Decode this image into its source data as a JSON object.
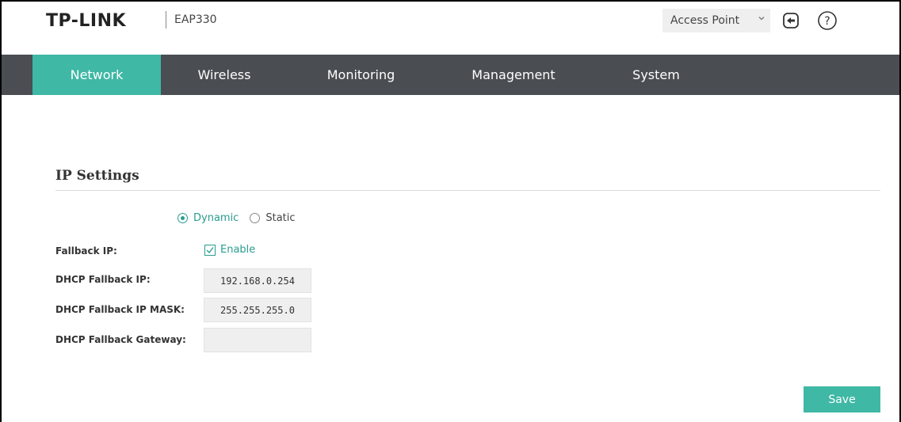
{
  "header": {
    "logo": "TP-LINK",
    "model": "EAP330",
    "mode_select": {
      "value": "Access Point",
      "icon": "chevron-down-icon"
    },
    "logout_icon": "logout-icon",
    "help_icon": "help-icon"
  },
  "nav": {
    "tabs": [
      {
        "label": "Network",
        "active": true
      },
      {
        "label": "Wireless",
        "active": false
      },
      {
        "label": "Monitoring",
        "active": false
      },
      {
        "label": "Management",
        "active": false
      },
      {
        "label": "System",
        "active": false
      }
    ]
  },
  "ip_settings": {
    "title": "IP Settings",
    "mode_options": [
      {
        "label": "Dynamic",
        "selected": true
      },
      {
        "label": "Static",
        "selected": false
      }
    ],
    "fallback_ip": {
      "label": "Fallback IP:",
      "checkbox_label": "Enable",
      "checked": true
    },
    "dhcp_fallback_ip": {
      "label": "DHCP Fallback IP:",
      "value": "192.168.0.254"
    },
    "dhcp_fallback_mask": {
      "label": "DHCP Fallback IP MASK:",
      "value": "255.255.255.0"
    },
    "dhcp_fallback_gateway": {
      "label": "DHCP Fallback Gateway:",
      "value": ""
    }
  },
  "actions": {
    "save_label": "Save"
  },
  "colors": {
    "accent": "#3fb8a5",
    "nav_bg": "#4a4d52",
    "checked_text": "#2a9d8f"
  }
}
